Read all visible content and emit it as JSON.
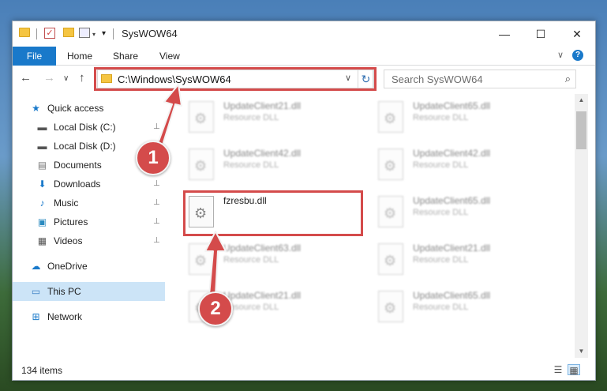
{
  "window": {
    "title": "SysWOW64",
    "controls": {
      "minimize": "—",
      "maximize": "☐",
      "close": "✕"
    }
  },
  "quick_access_toolbar": {
    "customize": "▾",
    "dropdown": "▾"
  },
  "ribbon": {
    "tabs": [
      {
        "label": "File"
      },
      {
        "label": "Home"
      },
      {
        "label": "Share"
      },
      {
        "label": "View"
      }
    ],
    "collapse": "∨",
    "help": "?"
  },
  "navigation": {
    "back": "←",
    "forward": "→",
    "recent": "∨",
    "up": "↑",
    "address": "C:\\Windows\\SysWOW64",
    "address_chevron": "∨",
    "refresh": "↻",
    "search_placeholder": "Search SysWOW64"
  },
  "nav_pane": {
    "items": [
      {
        "label": "Quick access",
        "icon": "star-icon",
        "glyph": "★",
        "level": 0,
        "pinned": false,
        "selected": false
      },
      {
        "label": "Local Disk (C:)",
        "icon": "drive-icon",
        "glyph": "▬",
        "level": 1,
        "pinned": true,
        "selected": false
      },
      {
        "label": "Local Disk (D:)",
        "icon": "drive-icon",
        "glyph": "▬",
        "level": 1,
        "pinned": true,
        "selected": false
      },
      {
        "label": "Documents",
        "icon": "document-icon",
        "glyph": "▤",
        "level": 1,
        "pinned": true,
        "selected": false
      },
      {
        "label": "Downloads",
        "icon": "download-icon",
        "glyph": "⬇",
        "level": 1,
        "pinned": true,
        "selected": false
      },
      {
        "label": "Music",
        "icon": "music-icon",
        "glyph": "♪",
        "level": 1,
        "pinned": true,
        "selected": false
      },
      {
        "label": "Pictures",
        "icon": "pictures-icon",
        "glyph": "▣",
        "level": 1,
        "pinned": true,
        "selected": false
      },
      {
        "label": "Videos",
        "icon": "video-icon",
        "glyph": "▦",
        "level": 1,
        "pinned": true,
        "selected": false
      },
      {
        "label": "OneDrive",
        "icon": "cloud-icon",
        "glyph": "☁",
        "level": 0,
        "pinned": false,
        "selected": false
      },
      {
        "label": "This PC",
        "icon": "computer-icon",
        "glyph": "▭",
        "level": 0,
        "pinned": false,
        "selected": true
      },
      {
        "label": "Network",
        "icon": "network-icon",
        "glyph": "⊞",
        "level": 0,
        "pinned": false,
        "selected": false
      }
    ],
    "pin_glyph": "📌"
  },
  "files": [
    {
      "name": "UpdateClient21.dll",
      "type": "Resource DLL",
      "blurred": true
    },
    {
      "name": "UpdateClient65.dll",
      "type": "Resource DLL",
      "blurred": true
    },
    {
      "name": "UpdateClient42.dll",
      "type": "Resource DLL",
      "blurred": true
    },
    {
      "name": "UpdateClient42.dll",
      "type": "Resource DLL",
      "blurred": true
    },
    {
      "name": "fzresbu.dll",
      "type": "",
      "blurred": false
    },
    {
      "name": "UpdateClient65.dll",
      "type": "Resource DLL",
      "blurred": true
    },
    {
      "name": "UpdateClient63.dll",
      "type": "Resource DLL",
      "blurred": true
    },
    {
      "name": "UpdateClient21.dll",
      "type": "Resource DLL",
      "blurred": true
    },
    {
      "name": "UpdateClient21.dll",
      "type": "Resource DLL",
      "blurred": true
    },
    {
      "name": "UpdateClient65.dll",
      "type": "Resource DLL",
      "blurred": true
    }
  ],
  "status": {
    "item_count": "134 items",
    "scroll_up": "▲",
    "scroll_down": "▼"
  },
  "annotations": [
    {
      "label": "1"
    },
    {
      "label": "2"
    }
  ],
  "colors": {
    "accent": "#1979ca",
    "highlight": "#d44b4b",
    "selection": "#cce4f7"
  }
}
